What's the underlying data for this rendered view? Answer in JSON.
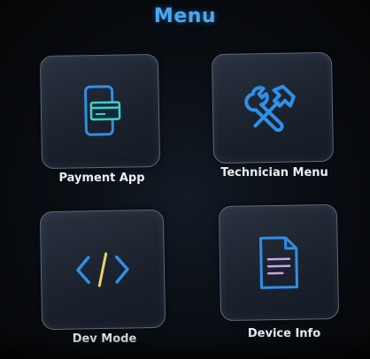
{
  "header": {
    "title": "Menu"
  },
  "menu": {
    "items": [
      {
        "label": "Payment App",
        "icon": "payment-app-icon"
      },
      {
        "label": "Technician Menu",
        "icon": "wrench-hammer-icon"
      },
      {
        "label": "Dev Mode",
        "icon": "code-brackets-icon"
      },
      {
        "label": "Device Info",
        "icon": "document-icon"
      }
    ]
  },
  "colors": {
    "accent": "#4aa8f0",
    "icon_blue": "#2f8fe6",
    "icon_yellow": "#e8d16a",
    "doc_lines": "#c9a3e8",
    "background": "#0a0e14",
    "tile": "#1f2630"
  }
}
